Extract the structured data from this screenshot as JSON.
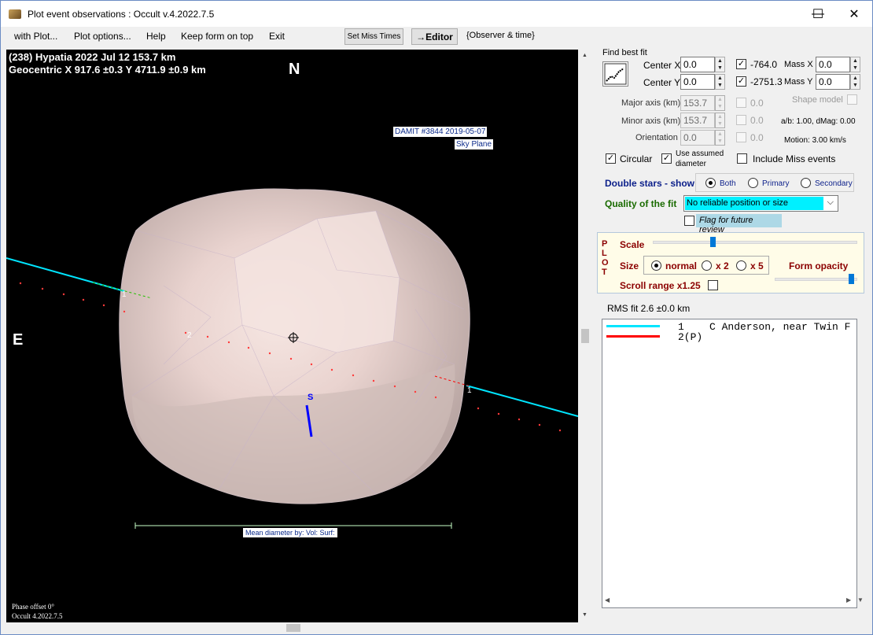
{
  "window": {
    "title": "Plot event observations : Occult v.4.2022.7.5",
    "minimize_glyph": "—",
    "maximize_glyph": "☐",
    "close_glyph": "✕"
  },
  "menu": {
    "items": [
      "with Plot...",
      "Plot options...",
      "Help",
      "Keep form on top",
      "Exit"
    ],
    "set_miss_times": "Set Miss Times",
    "editor": "→Editor",
    "observer_time": "{Observer & time}"
  },
  "plot": {
    "header_line1": "(238) Hypatia  2022 Jul 12   153.7 km",
    "header_line2": "Geocentric  X  917.6 ±0.3  Y 4711.9 ±0.9 km",
    "north": "N",
    "east": "E",
    "damit_line1": "DAMIT #3844 2019-05-07",
    "damit_line2": "Sky Plane",
    "south": "S",
    "chord1": "1",
    "chord2": "2",
    "mean_diameter": "Mean diameter by: Vol: Surf:",
    "phase_offset": "Phase offset 0°",
    "version": "Occult 4.2022.7.5"
  },
  "fit": {
    "find_best_fit": "Find best fit",
    "center_x_label": "Center X",
    "center_x": "0.0",
    "center_y_label": "Center Y",
    "center_y": "0.0",
    "offset_x": "-764.0",
    "offset_y": "-2751.3",
    "mass_x_label": "Mass X",
    "mass_x": "0.0",
    "mass_y_label": "Mass Y",
    "mass_y": "0.0",
    "major_label": "Major axis (km)",
    "major": "153.7",
    "major_chk": "0.0",
    "minor_label": "Minor axis (km)",
    "minor": "153.7",
    "minor_chk": "0.0",
    "orient_label": "Orientation",
    "orient": "0.0",
    "orient_chk": "0.0",
    "shape_model": "Shape model",
    "ab_dmag": "a/b: 1.00, dMag: 0.00",
    "motion": "Motion: 3.00 km/s",
    "circular": "Circular",
    "use_assumed_1": "Use assumed",
    "use_assumed_2": "diameter",
    "include_miss": "Include Miss events",
    "double_stars": "Double stars - show",
    "both": "Both",
    "primary": "Primary",
    "secondary": "Secondary",
    "quality_label": "Quality of the fit",
    "quality_value": "No reliable position or size",
    "flag_review": "Flag for future review"
  },
  "plotctl": {
    "vertical": "PLOT",
    "scale": "Scale",
    "scale_level": 0.29,
    "size": "Size",
    "normal": "normal",
    "x2": "x 2",
    "x5": "x 5",
    "form_opacity": "Form opacity",
    "opacity_level": 0.96,
    "scroll_range": "Scroll range x1.25"
  },
  "rms": "RMS fit 2.6 ±0.0 km",
  "legend": [
    {
      "num": "1",
      "name": "C Anderson, near Twin F",
      "color": "#00e5ff"
    },
    {
      "num": "2(P)",
      "name": "",
      "color": "#ff0000"
    }
  ]
}
